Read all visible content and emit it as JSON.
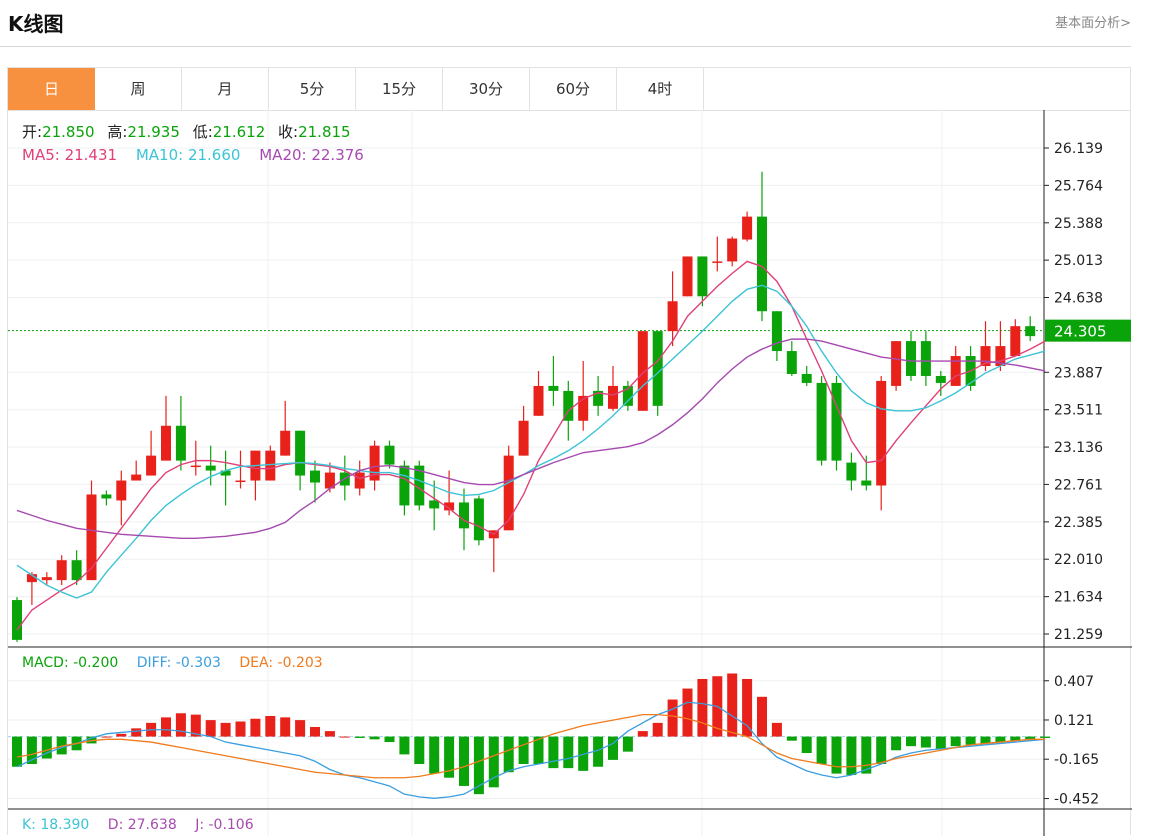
{
  "header": {
    "title": "K线图",
    "link": "基本面分析>"
  },
  "tabs": [
    {
      "label": "日",
      "active": true
    },
    {
      "label": "周",
      "active": false
    },
    {
      "label": "月",
      "active": false
    },
    {
      "label": "5分",
      "active": false
    },
    {
      "label": "15分",
      "active": false
    },
    {
      "label": "30分",
      "active": false
    },
    {
      "label": "60分",
      "active": false
    },
    {
      "label": "4时",
      "active": false
    }
  ],
  "ohlc_info": {
    "open_label": "开:",
    "open": "21.850",
    "high_label": "高:",
    "high": "21.935",
    "low_label": "低:",
    "low": "21.612",
    "close_label": "收:",
    "close": "21.815"
  },
  "ma_info": {
    "ma5": "MA5: 21.431",
    "ma10": "MA10: 21.660",
    "ma20": "MA20: 22.376"
  },
  "macd_info": {
    "macd": "MACD: -0.200",
    "diff": "DIFF: -0.303",
    "dea": "DEA: -0.203"
  },
  "kdj_info": {
    "k": "K: 18.390",
    "d": "D: 27.638",
    "j": "J: -0.106"
  },
  "colors": {
    "up": "#e8211a",
    "down": "#0aa30a",
    "ma5": "#e0407a",
    "ma10": "#3cc3d6",
    "ma20": "#a64ab0",
    "diff": "#3a9ee0",
    "dea": "#f07b1e",
    "accent": "#f7913f"
  },
  "chart_data": [
    {
      "type": "candlestick",
      "ylim": [
        21.259,
        26.139
      ],
      "yticks": [
        26.139,
        25.764,
        25.388,
        25.013,
        24.638,
        24.305,
        23.887,
        23.511,
        23.136,
        22.761,
        22.385,
        22.01,
        21.634,
        21.259
      ],
      "current_price": 24.305,
      "candles": [
        [
          21.6,
          21.2,
          21.63,
          21.18
        ],
        [
          21.78,
          21.86,
          21.88,
          21.55
        ],
        [
          21.8,
          21.83,
          21.88,
          21.75
        ],
        [
          21.8,
          22.0,
          22.05,
          21.75
        ],
        [
          22.0,
          21.8,
          22.1,
          21.75
        ],
        [
          21.8,
          22.66,
          22.8,
          21.8
        ],
        [
          22.66,
          22.62,
          22.7,
          22.55
        ],
        [
          22.6,
          22.8,
          22.9,
          22.35
        ],
        [
          22.8,
          22.86,
          23.0,
          22.82
        ],
        [
          22.85,
          23.05,
          23.3,
          22.85
        ],
        [
          23.0,
          23.35,
          23.65,
          23.0
        ],
        [
          23.35,
          23.0,
          23.65,
          22.9
        ],
        [
          22.95,
          22.95,
          23.2,
          22.85
        ],
        [
          22.95,
          22.9,
          23.15,
          22.75
        ],
        [
          22.9,
          22.85,
          23.1,
          22.55
        ],
        [
          22.8,
          22.8,
          23.1,
          22.72
        ],
        [
          22.8,
          23.1,
          23.1,
          22.6
        ],
        [
          22.8,
          23.1,
          23.15,
          22.8
        ],
        [
          23.05,
          23.3,
          23.6,
          23.05
        ],
        [
          23.3,
          22.85,
          23.3,
          22.7
        ],
        [
          22.9,
          22.78,
          23.0,
          22.58
        ],
        [
          22.72,
          22.88,
          22.98,
          22.68
        ],
        [
          22.88,
          22.75,
          23.05,
          22.6
        ],
        [
          22.72,
          22.88,
          23.0,
          22.65
        ],
        [
          22.8,
          23.15,
          23.2,
          22.7
        ],
        [
          23.15,
          22.96,
          23.2,
          22.92
        ],
        [
          22.95,
          22.55,
          23.0,
          22.45
        ],
        [
          22.95,
          22.55,
          23.0,
          22.5
        ],
        [
          22.6,
          22.52,
          22.8,
          22.3
        ],
        [
          22.5,
          22.58,
          22.9,
          22.45
        ],
        [
          22.58,
          22.32,
          22.72,
          22.1
        ],
        [
          22.62,
          22.2,
          22.65,
          22.15
        ],
        [
          22.22,
          22.3,
          22.3,
          21.88
        ],
        [
          22.3,
          23.05,
          23.15,
          22.3
        ],
        [
          23.05,
          23.4,
          23.55,
          23.05
        ],
        [
          23.45,
          23.75,
          23.9,
          23.45
        ],
        [
          23.75,
          23.7,
          24.05,
          23.55
        ],
        [
          23.7,
          23.4,
          23.8,
          23.2
        ],
        [
          23.4,
          23.65,
          24.0,
          23.3
        ],
        [
          23.7,
          23.55,
          23.85,
          23.45
        ],
        [
          23.52,
          23.75,
          23.95,
          23.5
        ],
        [
          23.75,
          23.55,
          23.8,
          23.5
        ],
        [
          23.5,
          24.3,
          24.3,
          23.5
        ],
        [
          24.3,
          23.55,
          24.3,
          23.45
        ],
        [
          24.3,
          24.6,
          24.9,
          24.15
        ],
        [
          24.65,
          25.05,
          25.05,
          24.65
        ],
        [
          25.05,
          24.65,
          25.05,
          24.55
        ],
        [
          25.0,
          25.0,
          25.25,
          24.9
        ],
        [
          25.0,
          25.23,
          25.25,
          24.95
        ],
        [
          25.22,
          25.45,
          25.5,
          25.2
        ],
        [
          25.45,
          24.5,
          25.9,
          24.4
        ],
        [
          24.5,
          24.1,
          24.5,
          24.0
        ],
        [
          24.1,
          23.87,
          24.2,
          23.85
        ],
        [
          23.87,
          23.78,
          23.95,
          23.75
        ],
        [
          23.78,
          23.0,
          23.85,
          22.95
        ],
        [
          23.78,
          23.0,
          23.85,
          22.9
        ],
        [
          22.98,
          22.8,
          23.08,
          22.7
        ],
        [
          22.8,
          22.75,
          23.05,
          22.7
        ],
        [
          22.75,
          23.8,
          23.85,
          22.5
        ],
        [
          23.75,
          24.2,
          24.2,
          23.7
        ],
        [
          24.2,
          23.85,
          24.3,
          23.8
        ],
        [
          24.2,
          23.85,
          24.3,
          23.75
        ],
        [
          23.85,
          23.78,
          23.9,
          23.65
        ],
        [
          23.75,
          24.05,
          24.15,
          23.75
        ],
        [
          24.05,
          23.75,
          24.15,
          23.7
        ],
        [
          23.95,
          24.15,
          24.4,
          23.9
        ],
        [
          23.95,
          24.15,
          24.4,
          23.9
        ],
        [
          24.05,
          24.35,
          24.42,
          24.05
        ],
        [
          24.35,
          24.25,
          24.45,
          24.2
        ]
      ]
    },
    {
      "type": "line",
      "series": [
        {
          "name": "MA5",
          "values": [
            21.3,
            21.5,
            21.6,
            21.7,
            21.78,
            21.92,
            22.12,
            22.32,
            22.52,
            22.72,
            22.88,
            22.96,
            23.0,
            23.0,
            22.98,
            22.95,
            22.92,
            22.92,
            22.96,
            22.98,
            22.96,
            22.94,
            22.9,
            22.82,
            22.86,
            22.86,
            22.82,
            22.72,
            22.62,
            22.52,
            22.4,
            22.34,
            22.26,
            22.4,
            22.66,
            23.0,
            23.25,
            23.5,
            23.62,
            23.68,
            23.66,
            23.72,
            23.88,
            24.0,
            24.2,
            24.45,
            24.6,
            24.75,
            24.88,
            25.0,
            24.95,
            24.8,
            24.55,
            24.22,
            23.9,
            23.55,
            23.2,
            22.98,
            23.0,
            23.2,
            23.38,
            23.55,
            23.72,
            23.85,
            23.9,
            23.98,
            24.0,
            24.05,
            24.12,
            24.2
          ]
        },
        {
          "name": "MA10",
          "values": [
            21.95,
            21.85,
            21.75,
            21.68,
            21.62,
            21.68,
            21.88,
            22.05,
            22.22,
            22.4,
            22.55,
            22.66,
            22.76,
            22.84,
            22.9,
            22.94,
            22.95,
            22.96,
            22.97,
            22.98,
            22.97,
            22.95,
            22.92,
            22.9,
            22.88,
            22.88,
            22.85,
            22.8,
            22.74,
            22.68,
            22.65,
            22.66,
            22.7,
            22.78,
            22.86,
            22.95,
            23.02,
            23.1,
            23.2,
            23.32,
            23.45,
            23.6,
            23.75,
            23.88,
            24.02,
            24.16,
            24.3,
            24.45,
            24.6,
            24.72,
            24.76,
            24.7,
            24.55,
            24.35,
            24.1,
            23.88,
            23.7,
            23.58,
            23.52,
            23.5,
            23.5,
            23.53,
            23.6,
            23.68,
            23.78,
            23.88,
            23.95,
            24.02,
            24.06,
            24.1
          ]
        },
        {
          "name": "MA20",
          "values": [
            22.5,
            22.45,
            22.4,
            22.36,
            22.32,
            22.3,
            22.28,
            22.26,
            22.25,
            22.24,
            22.23,
            22.22,
            22.22,
            22.23,
            22.24,
            22.26,
            22.28,
            22.32,
            22.38,
            22.5,
            22.6,
            22.72,
            22.82,
            22.9,
            22.94,
            22.95,
            22.93,
            22.9,
            22.86,
            22.82,
            22.78,
            22.76,
            22.76,
            22.8,
            22.86,
            22.92,
            22.98,
            23.03,
            23.08,
            23.1,
            23.12,
            23.14,
            23.18,
            23.26,
            23.36,
            23.48,
            23.62,
            23.78,
            23.92,
            24.04,
            24.12,
            24.18,
            24.22,
            24.22,
            24.2,
            24.16,
            24.12,
            24.08,
            24.04,
            24.02,
            24.0,
            24.0,
            24.0,
            24.0,
            24.0,
            24.0,
            23.98,
            23.96,
            23.93,
            23.9
          ]
        }
      ]
    },
    {
      "type": "bar",
      "name": "MACD",
      "ylim": [
        -0.55,
        0.5
      ],
      "yticks": [
        0.407,
        0.121,
        -0.165,
        -0.452
      ],
      "values": [
        -0.22,
        -0.2,
        -0.16,
        -0.13,
        -0.1,
        -0.05,
        0.0,
        0.02,
        0.06,
        0.1,
        0.14,
        0.17,
        0.16,
        0.12,
        0.1,
        0.11,
        0.13,
        0.15,
        0.14,
        0.12,
        0.07,
        0.04,
        0.0,
        -0.01,
        -0.02,
        -0.04,
        -0.13,
        -0.2,
        -0.27,
        -0.3,
        -0.36,
        -0.42,
        -0.37,
        -0.26,
        -0.2,
        -0.2,
        -0.23,
        -0.23,
        -0.25,
        -0.22,
        -0.17,
        -0.11,
        0.04,
        0.1,
        0.27,
        0.35,
        0.42,
        0.44,
        0.46,
        0.42,
        0.29,
        0.1,
        -0.03,
        -0.12,
        -0.2,
        -0.27,
        -0.28,
        -0.27,
        -0.2,
        -0.1,
        -0.07,
        -0.08,
        -0.09,
        -0.07,
        -0.06,
        -0.05,
        -0.04,
        -0.03,
        -0.02,
        -0.01
      ]
    },
    {
      "type": "line",
      "series": [
        {
          "name": "DIFF",
          "values": [
            -0.22,
            -0.17,
            -0.12,
            -0.08,
            -0.05,
            -0.01,
            0.02,
            0.03,
            0.04,
            0.05,
            0.05,
            0.04,
            0.02,
            0.0,
            -0.04,
            -0.06,
            -0.08,
            -0.1,
            -0.12,
            -0.14,
            -0.18,
            -0.24,
            -0.28,
            -0.3,
            -0.33,
            -0.36,
            -0.42,
            -0.44,
            -0.45,
            -0.44,
            -0.42,
            -0.36,
            -0.3,
            -0.25,
            -0.22,
            -0.2,
            -0.18,
            -0.16,
            -0.13,
            -0.1,
            -0.05,
            0.04,
            0.1,
            0.16,
            0.2,
            0.25,
            0.24,
            0.22,
            0.15,
            0.08,
            -0.05,
            -0.15,
            -0.2,
            -0.25,
            -0.28,
            -0.3,
            -0.28,
            -0.24,
            -0.2,
            -0.15,
            -0.12,
            -0.1,
            -0.09,
            -0.08,
            -0.07,
            -0.06,
            -0.05,
            -0.04,
            -0.03,
            -0.02
          ]
        },
        {
          "name": "DEA",
          "values": [
            -0.15,
            -0.13,
            -0.1,
            -0.07,
            -0.05,
            -0.03,
            -0.02,
            -0.02,
            -0.03,
            -0.04,
            -0.06,
            -0.08,
            -0.1,
            -0.12,
            -0.14,
            -0.16,
            -0.18,
            -0.2,
            -0.22,
            -0.24,
            -0.26,
            -0.27,
            -0.28,
            -0.29,
            -0.3,
            -0.3,
            -0.3,
            -0.29,
            -0.27,
            -0.25,
            -0.22,
            -0.18,
            -0.14,
            -0.1,
            -0.06,
            -0.02,
            0.02,
            0.05,
            0.08,
            0.1,
            0.12,
            0.14,
            0.16,
            0.16,
            0.15,
            0.13,
            0.1,
            0.06,
            0.03,
            0.0,
            -0.06,
            -0.12,
            -0.16,
            -0.18,
            -0.2,
            -0.22,
            -0.22,
            -0.21,
            -0.19,
            -0.16,
            -0.14,
            -0.12,
            -0.1,
            -0.08,
            -0.06,
            -0.05,
            -0.04,
            -0.03,
            -0.02,
            -0.02
          ]
        }
      ]
    }
  ]
}
